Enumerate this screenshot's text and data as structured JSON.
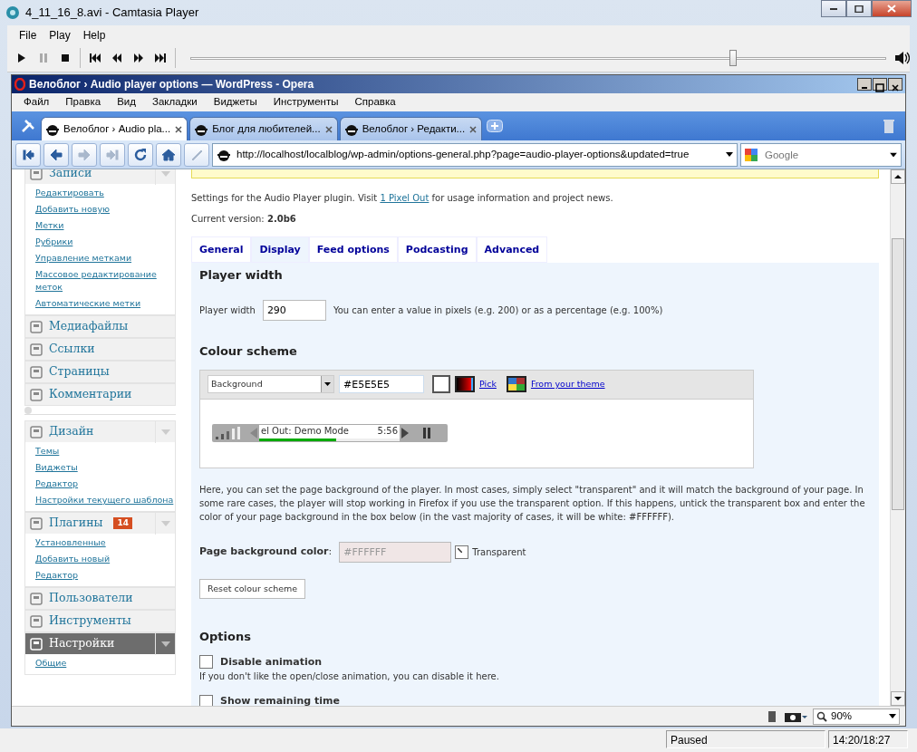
{
  "player": {
    "title": "4_11_16_8.avi - Camtasia Player",
    "menu": [
      "File",
      "Play",
      "Help"
    ],
    "controls": [
      {
        "kind": "play",
        "disabled": false
      },
      {
        "kind": "pause",
        "disabled": true
      },
      {
        "kind": "stop",
        "disabled": false
      },
      {
        "kind": "first",
        "disabled": false
      },
      {
        "kind": "rewind",
        "disabled": false
      },
      {
        "kind": "forward",
        "disabled": false
      },
      {
        "kind": "last",
        "disabled": false
      }
    ],
    "seek": {
      "level": 0.78
    },
    "status": "Paused",
    "time": "14:20/18:27"
  },
  "browser": {
    "title": "Велоблог › Audio player options — WordPress - Opera",
    "menu": [
      "Файл",
      "Правка",
      "Вид",
      "Закладки",
      "Виджеты",
      "Инструменты",
      "Справка"
    ],
    "tabs": [
      {
        "label": "Велоблог › Audio pla...",
        "selected": true
      },
      {
        "label": "Блог для любителей...",
        "selected": false
      },
      {
        "label": "Велоблог › Редакти...",
        "selected": false
      }
    ],
    "nav": [
      {
        "kind": "first",
        "disabled": false
      },
      {
        "kind": "back",
        "disabled": false
      },
      {
        "kind": "forward",
        "disabled": true
      },
      {
        "kind": "last",
        "disabled": true
      },
      {
        "kind": "reload",
        "disabled": false
      },
      {
        "kind": "home",
        "disabled": false
      },
      {
        "kind": "edit",
        "disabled": true
      }
    ],
    "url": "http://localhost/localblog/wp-admin/options-general.php?page=audio-player-options&updated=true",
    "search": {
      "placeholder": "Google"
    },
    "zoom": "90%"
  },
  "sidebar": [
    {
      "label": "Записи",
      "expanded": true,
      "selected": false,
      "items": [
        "Редактировать",
        "Добавить новую",
        "Метки",
        "Рубрики",
        "Управление метками",
        "Массовое редактирование меток",
        "Автоматические метки"
      ]
    },
    {
      "label": "Медиафайлы",
      "expanded": false,
      "selected": false
    },
    {
      "label": "Ссылки",
      "expanded": false,
      "selected": false
    },
    {
      "label": "Страницы",
      "expanded": false,
      "selected": false
    },
    {
      "label": "Комментарии",
      "expanded": false,
      "selected": false
    },
    {
      "label": "Дизайн",
      "expanded": true,
      "selected": false,
      "separator": true,
      "items": [
        "Темы",
        "Виджеты",
        "Редактор",
        "Настройки текущего шаблона"
      ]
    },
    {
      "label": "Плагины",
      "expanded": true,
      "selected": false,
      "badge": "14",
      "items": [
        "Установленные",
        "Добавить новый",
        "Редактор"
      ]
    },
    {
      "label": "Пользователи",
      "expanded": false,
      "selected": false
    },
    {
      "label": "Инструменты",
      "expanded": false,
      "selected": false
    },
    {
      "label": "Настройки",
      "expanded": true,
      "selected": true,
      "items": [
        "Общие"
      ]
    }
  ],
  "page": {
    "intro": {
      "before": "Settings for the Audio Player plugin. Visit ",
      "link": "1 Pixel Out",
      "after": " for usage information and project news."
    },
    "version": "Current version: **2.0b6**",
    "tabs": [
      {
        "label": "General",
        "selected": false
      },
      {
        "label": "Display",
        "selected": true
      },
      {
        "label": "Feed options",
        "selected": false
      },
      {
        "label": "Podcasting",
        "selected": false
      },
      {
        "label": "Advanced",
        "selected": false
      }
    ],
    "player_width": {
      "heading": "Player width",
      "label": "Player width",
      "value": "290",
      "hint": "You can enter a value in pixels (e.g. 200) or as a percentage (e.g. 100%)"
    },
    "colour_scheme": {
      "heading": "Colour scheme",
      "element": "Background",
      "value": "#E5E5E5",
      "pick": "Pick",
      "theme": "From your theme",
      "preview": {
        "text": "el Out: Demo Mode",
        "time": "5:56",
        "level": 0.55
      }
    },
    "description": "Here, you can set the page background of the player. In most cases, simply select \"transparent\" and it will match the background of your page. In some rare cases, the player will stop working in Firefox if you use the transparent option. If this happens, untick the transparent box and enter the color of your page background in the box below (in the vast majority of cases, it will be white: #FFFFFF).",
    "page_bg": {
      "label": "**Page background color**:",
      "value": "#FFFFFF",
      "disabled": true,
      "transparent": {
        "label": "Transparent",
        "checked": true
      }
    },
    "reset": "Reset colour scheme",
    "options": {
      "heading": "Options",
      "items": [
        {
          "label": "Disable animation",
          "checked": false,
          "description": "If you don't like the open/close animation, you can disable it here."
        },
        {
          "label": "Show remaining time",
          "checked": false
        }
      ]
    }
  }
}
